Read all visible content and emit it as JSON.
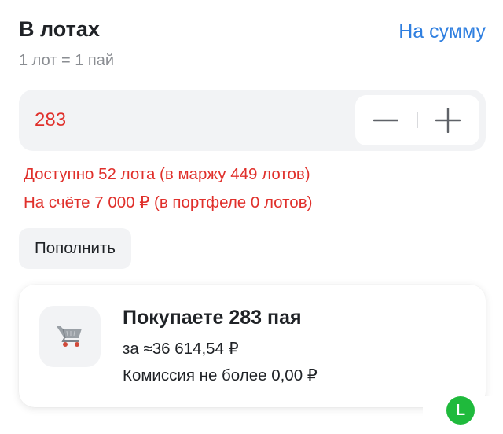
{
  "header": {
    "title": "В лотах",
    "mode_link": "На сумму",
    "subtitle": "1 лот = 1 пай"
  },
  "quantity": {
    "value": "283"
  },
  "warnings": [
    "Доступно 52 лота (в маржу 449 лотов)",
    "На счёте 7 000 ₽ (в портфеле 0 лотов)"
  ],
  "topup_button": "Пополнить",
  "order": {
    "title": "Покупаете 283 пая",
    "sum_text": "за ≈36 614,54 ₽",
    "fee_text": "Комиссия не более 0,00 ₽",
    "icon": "shopping-cart-icon"
  },
  "badge": {
    "text": "L",
    "color": "#1fba3c"
  },
  "colors": {
    "accent": "#2f7fe0",
    "error": "#e0302b",
    "field_bg": "#f2f3f5"
  }
}
